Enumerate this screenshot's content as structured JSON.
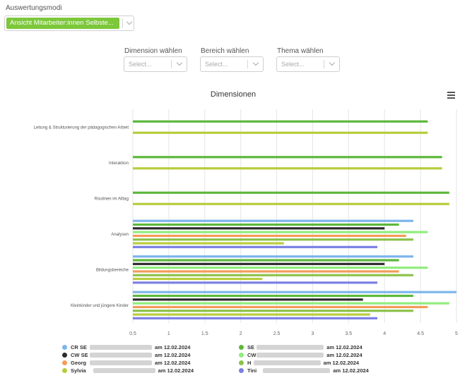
{
  "mode": {
    "label": "Auswertungsmodi",
    "selected": "Ansicht Mitarbeiter:innen Selbste..."
  },
  "filters": [
    {
      "label": "Dimension wählen",
      "placeholder": "Select..."
    },
    {
      "label": "Bereich wählen",
      "placeholder": "Select..."
    },
    {
      "label": "Thema wählen",
      "placeholder": "Select..."
    }
  ],
  "menu_icon": "hamburger-menu-icon",
  "chart_data": {
    "type": "bar",
    "orientation": "horizontal",
    "title": "Dimensionen",
    "categories": [
      "Leitung & Strukturierung der pädagogischen Arbeit",
      "Interaktion",
      "Routinen im Alltag",
      "Analysen",
      "Bildungsbereiche",
      "Kleinkinder und jüngere Kinder"
    ],
    "xlim": [
      0.5,
      5.0
    ],
    "xticks": [
      "0.5",
      "1",
      "1.5",
      "2",
      "2.5",
      "3",
      "3.5",
      "4",
      "4.5",
      "5"
    ],
    "grid": true,
    "legend_position": "bottom",
    "series": [
      {
        "name": "CR SE",
        "suffix": "am 12.02.2024",
        "color": "#7cb5ec",
        "values": [
          null,
          null,
          null,
          4.4,
          4.4,
          5.0
        ]
      },
      {
        "name": "SE",
        "suffix": "am 12.02.2024",
        "color": "#5cb83a",
        "values": [
          4.6,
          4.8,
          4.9,
          4.2,
          4.2,
          4.4
        ]
      },
      {
        "name": "CW SE",
        "suffix": "am 12.02.2024",
        "color": "#2b2b2b",
        "values": [
          null,
          null,
          null,
          4.0,
          4.0,
          3.7
        ]
      },
      {
        "name": "CW",
        "suffix": "am 12.02.2024",
        "color": "#90ed7d",
        "values": [
          null,
          null,
          null,
          4.6,
          4.6,
          4.9
        ]
      },
      {
        "name": "Georg",
        "suffix": "am 12.02.2024",
        "color": "#f39c5a",
        "values": [
          null,
          null,
          null,
          4.3,
          4.2,
          4.6
        ]
      },
      {
        "name": "H",
        "suffix": "am 12.02.2024",
        "color": "#8bc34a",
        "values": [
          null,
          null,
          null,
          4.4,
          4.4,
          4.4
        ]
      },
      {
        "name": "Sylvia",
        "suffix": "am 12.02.2024",
        "color": "#b8cc3c",
        "values": [
          4.6,
          4.8,
          4.9,
          2.6,
          2.3,
          3.8
        ]
      },
      {
        "name": "Tini",
        "suffix": "am 12.02.2024",
        "color": "#7b7fe3",
        "values": [
          null,
          null,
          null,
          3.9,
          3.9,
          3.9
        ]
      }
    ]
  }
}
